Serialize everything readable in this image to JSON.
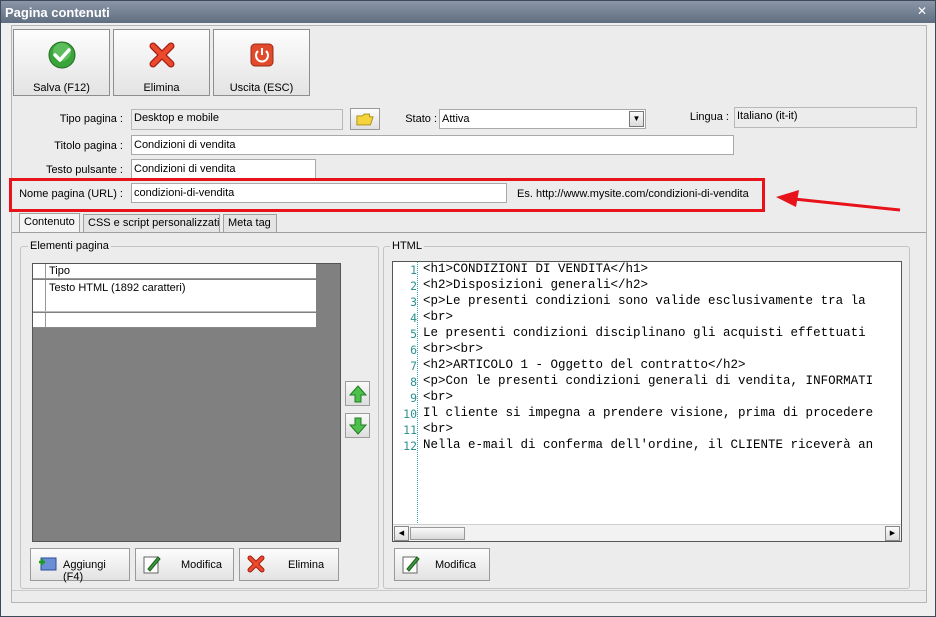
{
  "window": {
    "title": "Pagina contenuti"
  },
  "toolbar": {
    "save_label": "Salva (F12)",
    "delete_label": "Elimina",
    "exit_label": "Uscita (ESC)"
  },
  "form": {
    "page_type_label": "Tipo pagina :",
    "page_type_value": "Desktop e mobile",
    "status_label": "Stato :",
    "status_value": "Attiva",
    "language_label": "Lingua :",
    "language_value": "Italiano (it-it)",
    "page_title_label": "Titolo pagina :",
    "page_title_value": "Condizioni di vendita",
    "button_text_label": "Testo pulsante :",
    "button_text_value": "Condizioni di vendita",
    "page_name_label": "Nome pagina (URL) :",
    "page_name_value": "condizioni-di-vendita",
    "page_name_example": "Es. http://www.mysite.com/condizioni-di-vendita"
  },
  "tabs": [
    {
      "label": "Contenuto"
    },
    {
      "label": "CSS e script personalizzati"
    },
    {
      "label": "Meta tag"
    }
  ],
  "elements": {
    "group_title": "Elementi pagina",
    "column_header": "Tipo",
    "rows": [
      "Testo HTML (1892 caratteri)"
    ],
    "add_label": "Aggiungi (F4)",
    "edit_label": "Modifica",
    "delete_label": "Elimina"
  },
  "html_panel": {
    "group_title": "HTML",
    "line_numbers": [
      "1",
      "2",
      "3",
      "4",
      "5",
      "6",
      "7",
      "8",
      "9",
      "10",
      "11",
      "12"
    ],
    "lines": [
      "<h1>CONDIZIONI DI VENDITA</h1>",
      "<h2>Disposizioni generali</h2>",
      "<p>Le presenti condizioni sono valide esclusivamente tra la",
      "<br>",
      "Le presenti condizioni disciplinano gli acquisti effettuati",
      "<br><br>",
      "<h2>ARTICOLO 1 - Oggetto del contratto</h2>",
      "<p>Con le presenti condizioni generali di vendita, INFORMATI",
      "<br>",
      "Il cliente si impegna a prendere visione, prima di procedere",
      "<br>",
      "Nella e-mail di conferma dell'ordine, il CLIENTE riceverà an"
    ],
    "edit_label": "Modifica"
  },
  "colors": {
    "highlight": "#e8121b",
    "line_number": "#2e9090"
  }
}
